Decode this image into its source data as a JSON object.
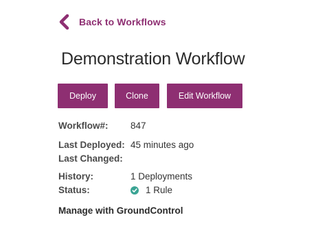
{
  "nav": {
    "back_label": "Back to Workflows"
  },
  "page": {
    "title": "Demonstration Workflow"
  },
  "actions": {
    "deploy_label": "Deploy",
    "clone_label": "Clone",
    "edit_label": "Edit Workflow"
  },
  "details": {
    "workflow_number_label": "Workflow#:",
    "workflow_number_value": "847",
    "last_deployed_label": "Last Deployed:",
    "last_deployed_value": "45 minutes ago",
    "last_changed_label": "Last Changed:",
    "last_changed_value": "",
    "history_label": "History:",
    "history_value": "1 Deployments",
    "status_label": "Status:",
    "status_value": "1 Rule",
    "status_icon": "check-circle-icon"
  },
  "footer": {
    "manage_text": "Manage with GroundControl"
  },
  "colors": {
    "brand": "#8e2f72",
    "status_ok": "#3aa494",
    "text": "#333333"
  }
}
